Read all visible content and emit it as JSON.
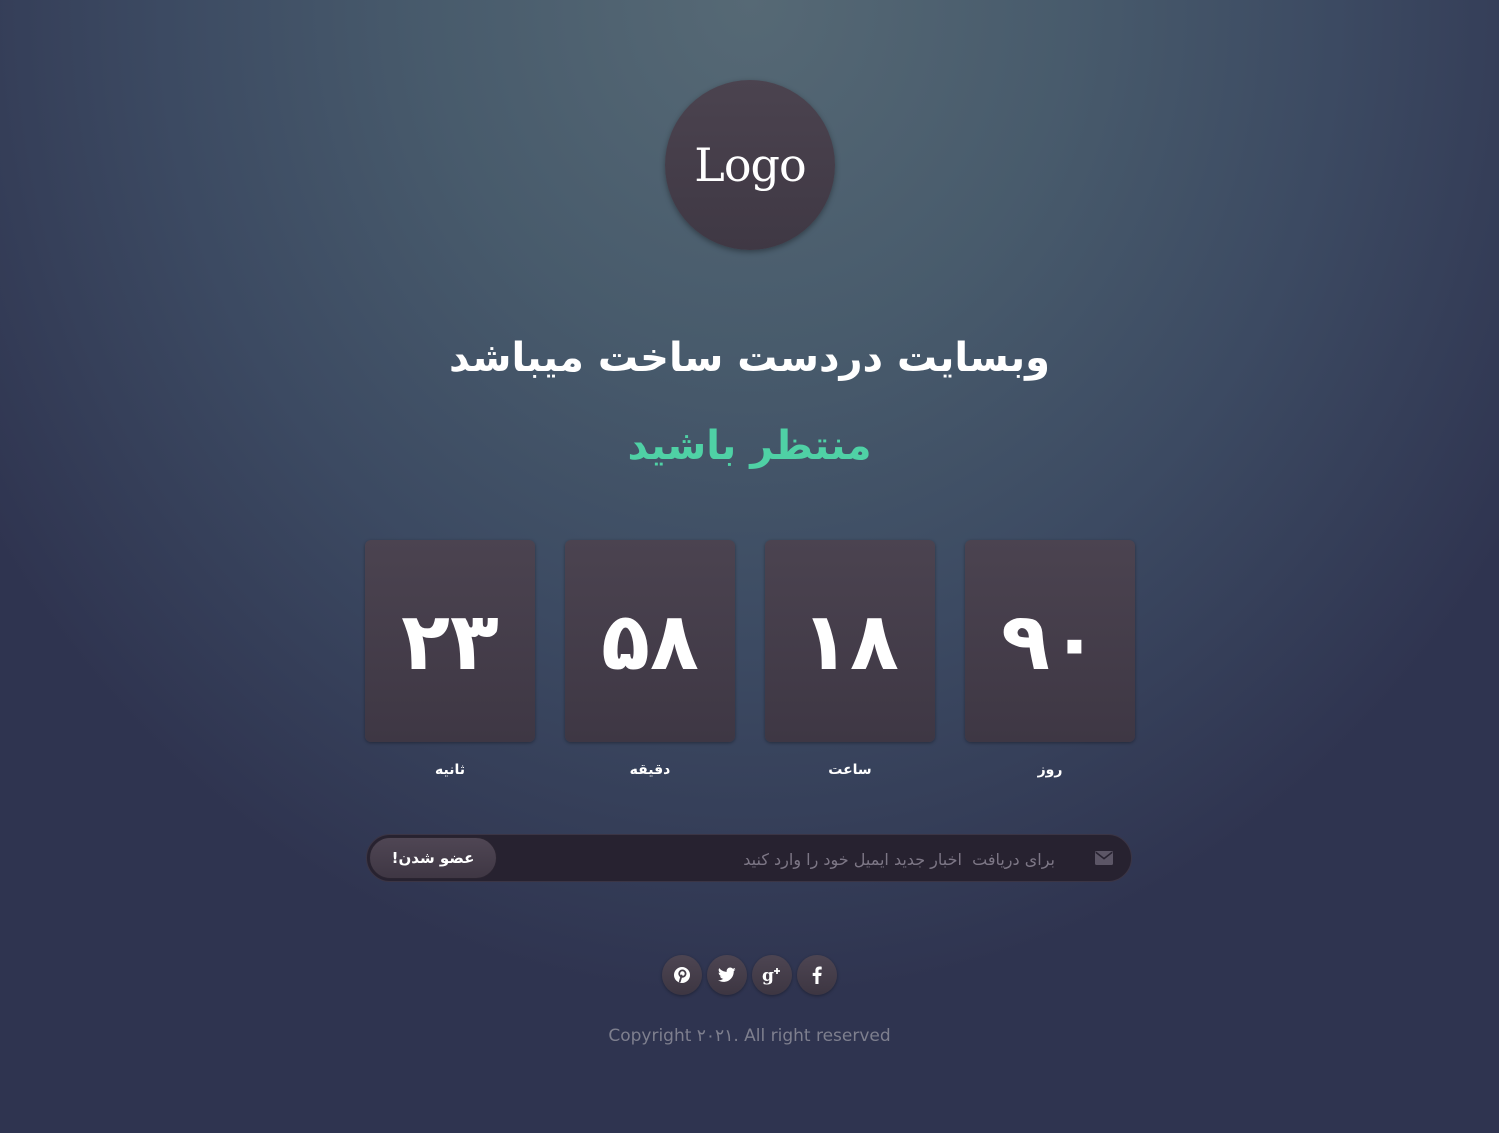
{
  "logo": {
    "text": "Logo"
  },
  "headline": "وبسایت دردست ساخت میباشد",
  "subline": "منتظر باشید",
  "countdown": [
    {
      "value": "۹۰",
      "label": "روز"
    },
    {
      "value": "۱۸",
      "label": "ساعت"
    },
    {
      "value": "۵۸",
      "label": "دقیقه"
    },
    {
      "value": "۲۳",
      "label": "ثانیه"
    }
  ],
  "subscribe": {
    "placeholder": "برای دریافت  اخبار جدید ایمیل خود را وارد کنید",
    "value": "",
    "button_label": "عضو شدن!",
    "icon": "envelope-icon"
  },
  "social": [
    {
      "name": "facebook",
      "icon": "facebook-icon"
    },
    {
      "name": "google-plus",
      "icon": "google-plus-icon"
    },
    {
      "name": "twitter",
      "icon": "twitter-icon"
    },
    {
      "name": "pinterest",
      "icon": "pinterest-icon"
    }
  ],
  "footer": {
    "copyright": "Copyright ۲۰۲۱. All right reserved"
  },
  "colors": {
    "accent": "#4fd1a5",
    "tile": "#463f4b",
    "input_bg": "#272230",
    "muted_text": "#7e7f8e"
  }
}
